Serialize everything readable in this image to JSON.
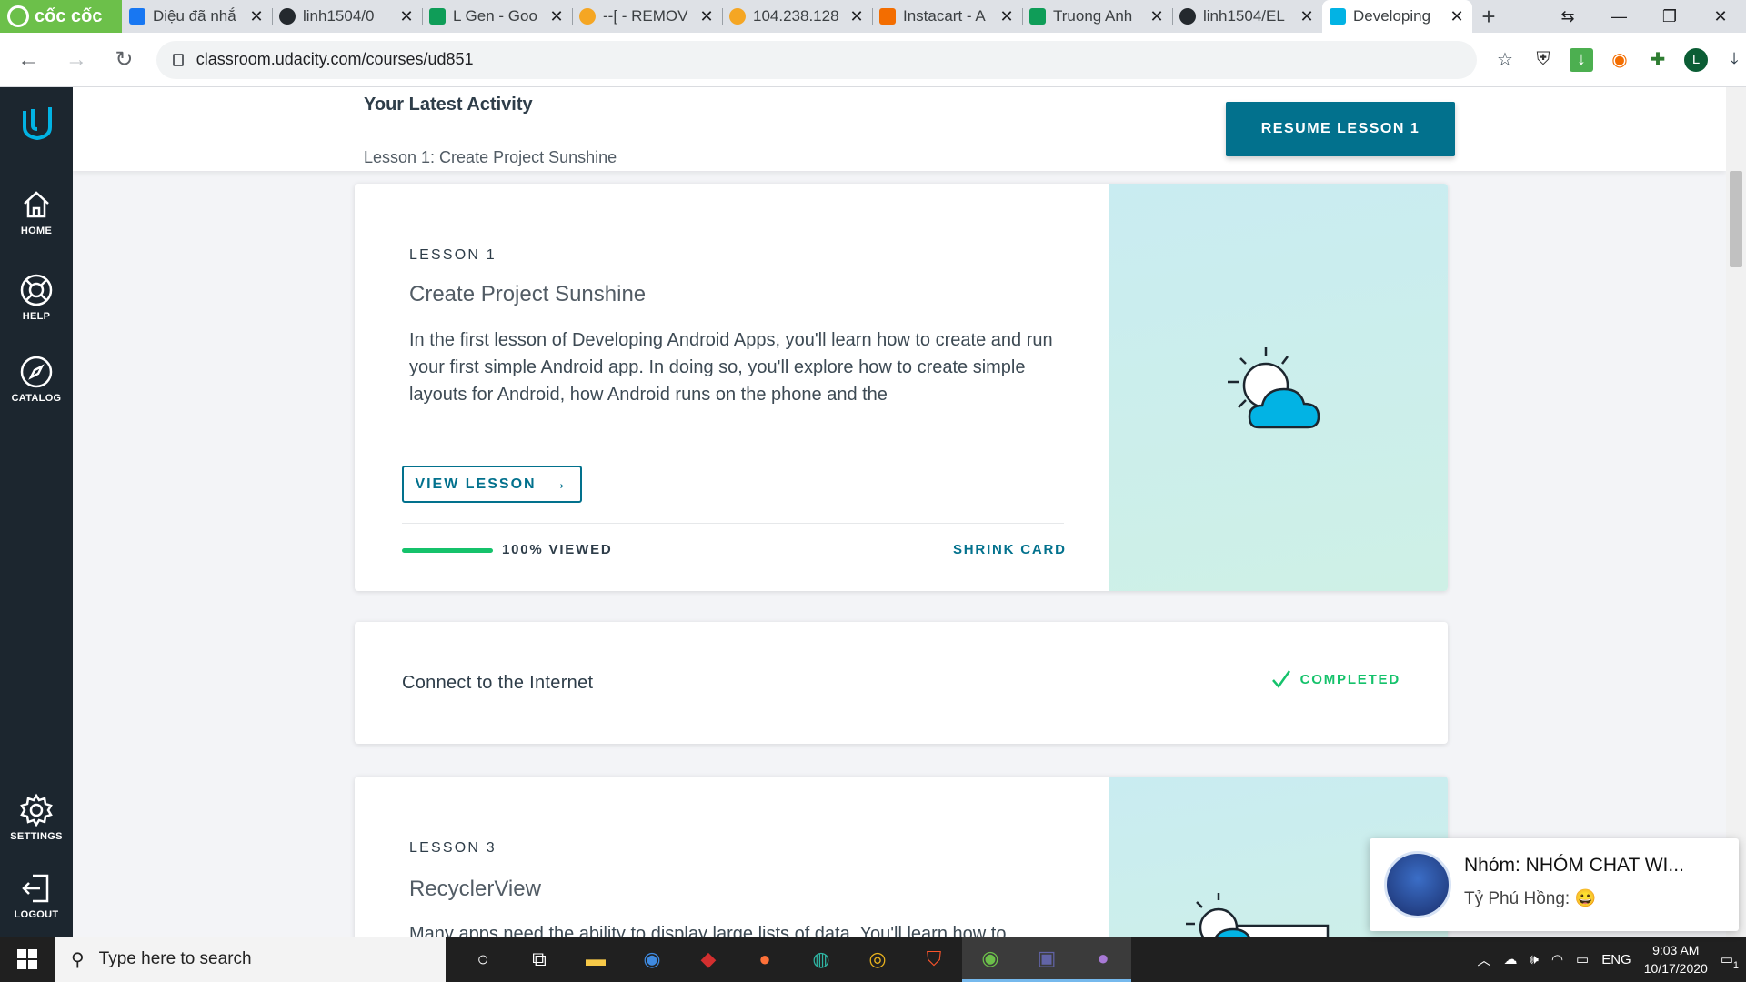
{
  "browser": {
    "brand": "cốc cốc",
    "tabs": [
      {
        "title": "Diệu đã nhắ",
        "color": "#1877f2"
      },
      {
        "title": "linh1504/0",
        "color": "#24292e"
      },
      {
        "title": "L Gen - Goo",
        "color": "#0f9d58"
      },
      {
        "title": "--[ - REMOV",
        "color": "#f5a623"
      },
      {
        "title": "104.238.128",
        "color": "#f5a623"
      },
      {
        "title": "Instacart - A",
        "color": "#f36d00"
      },
      {
        "title": "Truong Anh",
        "color": "#0f9d58"
      },
      {
        "title": "linh1504/EL",
        "color": "#24292e"
      },
      {
        "title": "Developing",
        "color": "#02b3e4"
      }
    ],
    "url": "classroom.udacity.com/courses/ud851",
    "profile_initial": "L"
  },
  "sidebar": {
    "items": [
      {
        "label": "HOME",
        "icon": "home-icon"
      },
      {
        "label": "HELP",
        "icon": "help-icon"
      },
      {
        "label": "CATALOG",
        "icon": "compass-icon"
      },
      {
        "label": "SETTINGS",
        "icon": "gear-icon"
      },
      {
        "label": "LOGOUT",
        "icon": "logout-icon"
      }
    ]
  },
  "latest": {
    "heading": "Your Latest Activity",
    "lesson": "Lesson 1: Create Project Sunshine",
    "resume_label": "RESUME LESSON 1"
  },
  "lesson1": {
    "kicker": "LESSON 1",
    "title": "Create Project Sunshine",
    "description": "In the first lesson of Developing Android Apps, you'll learn how to create and run your first simple Android app. In doing so, you'll explore how to create simple layouts for Android, how Android runs on the phone and the",
    "view_label": "VIEW LESSON",
    "progress": 1.0,
    "progress_label": "100% VIEWED",
    "shrink_label": "SHRINK CARD"
  },
  "lesson2": {
    "title": "Connect to the Internet",
    "status": "COMPLETED"
  },
  "lesson3": {
    "kicker": "LESSON 3",
    "title": "RecyclerView",
    "description": "Many apps need the ability to display large lists of data. You'll learn how to"
  },
  "notification": {
    "title": "Nhóm: NHÓM CHAT WI...",
    "message": "Tỷ Phú Hồng: 😀"
  },
  "taskbar": {
    "search_placeholder": "Type here to search",
    "language": "ENG",
    "time": "9:03 AM",
    "date": "10/17/2020",
    "notification_count": "1"
  },
  "colors": {
    "accent": "#02718d",
    "success": "#15c26b",
    "sidebar": "#1c262f"
  }
}
